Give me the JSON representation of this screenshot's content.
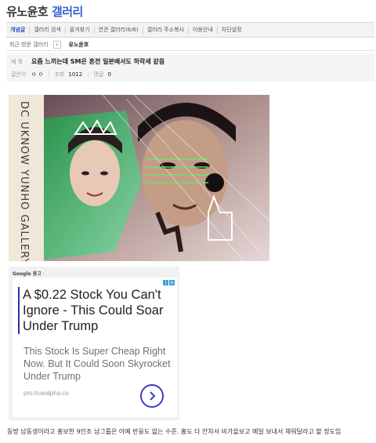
{
  "header": {
    "title_prefix": "유노윤호",
    "title_accent": "갤러리"
  },
  "tabs": [
    {
      "label": "개념글",
      "active": true
    },
    {
      "label": "갤러리 검색"
    },
    {
      "label": "즐겨찾기"
    },
    {
      "label": "연관 갤러리(6/6)"
    },
    {
      "label": "갤러리 주소복사"
    },
    {
      "label": "이용안내"
    },
    {
      "label": "차단설정"
    }
  ],
  "subnav": {
    "recent_label": "최근 방문 갤러리",
    "prev_symbol": "‹",
    "current": "유노윤호"
  },
  "post": {
    "subject_label": "제 목",
    "subject": "요즘 느끼는데 SM은 혼전 일본배서도 하락세 같음",
    "author_label": "글쓴이",
    "author": "ㅇ ㅇ",
    "views_label": "조회",
    "views": "1012",
    "comments_label": "댓글",
    "comments": "0"
  },
  "image": {
    "vertical_text": "DC UKNOW YUNHO GALLERY"
  },
  "ad": {
    "label": "Google 광고",
    "label_suffix": " ·",
    "title": "A $0.22 Stock You Can't Ignore - This Could Soar Under Trump",
    "description": "This Stock Is Super Cheap Right Now. But It Could Soon Skyrocket Under Trump",
    "url": "pro.truealpha.co",
    "badge_i": "i",
    "badge_x": "x",
    "accent_color": "#3a3fc0"
  },
  "body_text": "동방 남동생이라고 홍보한 9인조 남그룹은 아예 반응도 없는 수준. 홈도 다 안차서 비가을보고 메일 보내서 채워달라고 할 정도임"
}
